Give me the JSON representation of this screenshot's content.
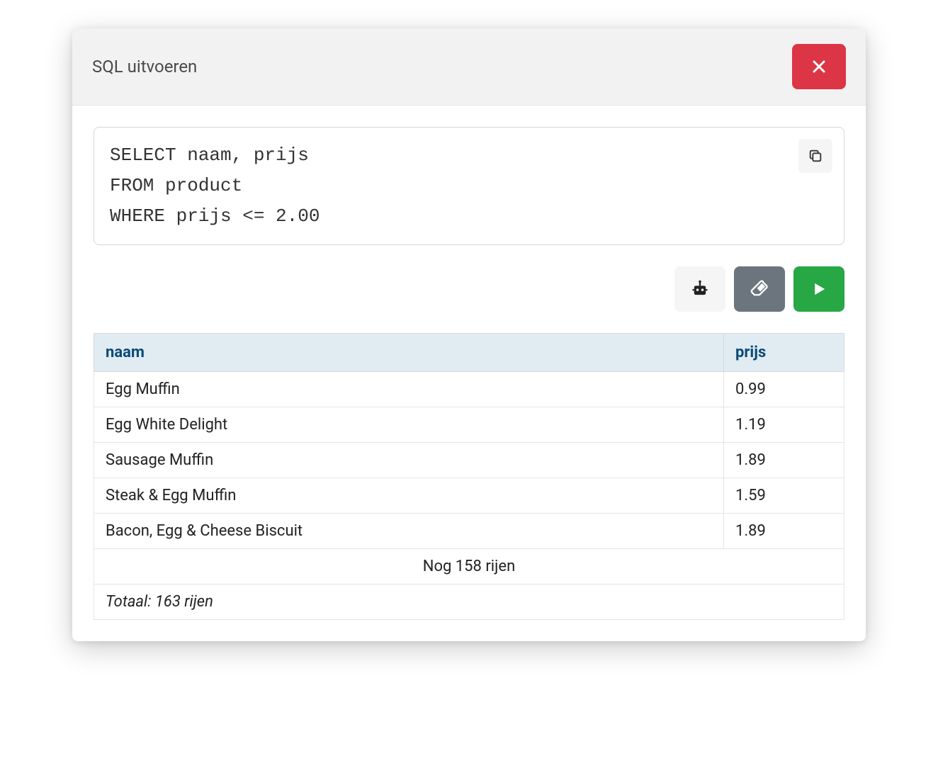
{
  "header": {
    "title": "SQL uitvoeren"
  },
  "editor": {
    "sql": "SELECT naam, prijs\nFROM product\nWHERE prijs <= 2.00"
  },
  "results": {
    "columns": [
      "naam",
      "prijs"
    ],
    "rows": [
      {
        "naam": "Egg Muffin",
        "prijs": "0.99"
      },
      {
        "naam": "Egg White Delight",
        "prijs": "1.19"
      },
      {
        "naam": "Sausage Muffin",
        "prijs": "1.89"
      },
      {
        "naam": "Steak & Egg Muffin",
        "prijs": "1.59"
      },
      {
        "naam": "Bacon, Egg & Cheese Biscuit",
        "prijs": "1.89"
      }
    ],
    "more_rows_text": "Nog 158 rijen",
    "total_text": "Totaal: 163 rijen"
  },
  "icons": {
    "close": "close-icon",
    "copy": "copy-icon",
    "robot": "robot-icon",
    "eraser": "eraser-icon",
    "run": "play-icon"
  }
}
